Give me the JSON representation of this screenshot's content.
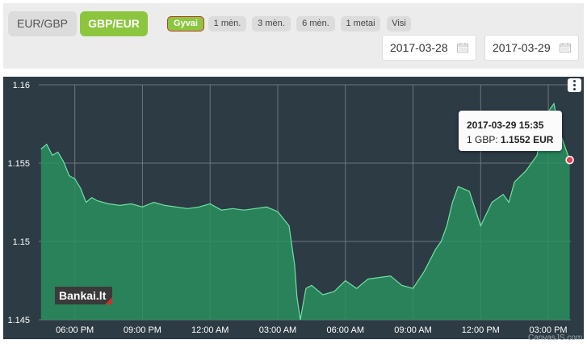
{
  "pair_tabs": [
    {
      "label": "EUR/GBP",
      "active": false
    },
    {
      "label": "GBP/EUR",
      "active": true
    }
  ],
  "range_buttons": [
    {
      "label": "Gyvai",
      "active": true
    },
    {
      "label": "1 mėn.",
      "active": false
    },
    {
      "label": "3 mėn.",
      "active": false
    },
    {
      "label": "6 mėn.",
      "active": false
    },
    {
      "label": "1 metai",
      "active": false
    },
    {
      "label": "Visi",
      "active": false
    }
  ],
  "date_from": "2017-03-28",
  "date_to": "2017-03-29",
  "icons": {
    "calendar": "calendar-icon",
    "menu": "more-vertical-icon"
  },
  "colors": {
    "accent": "#8cc63e",
    "chart_bg": "#2d3b44",
    "area_fill": "#2a8f5e",
    "line": "#6fe3a3",
    "marker": "#e04050"
  },
  "tooltip": {
    "date": "2017-03-29 15:35",
    "label": "1 GBP:",
    "value": "1.1552 EUR"
  },
  "watermark": "Bankai.lt",
  "credit": "CanvasJS.com",
  "chart_data": {
    "type": "area",
    "title": "",
    "xlabel": "",
    "ylabel": "",
    "ylim": [
      1.145,
      1.16
    ],
    "yticks": [
      "1.16",
      "1.155",
      "1.15",
      "1.145"
    ],
    "xticks": [
      "06:00 PM",
      "09:00 PM",
      "12:00 AM",
      "03:00 AM",
      "06:00 AM",
      "09:00 AM",
      "12:00 PM",
      "03:00 PM"
    ],
    "x_hours": [
      -1.5,
      -1.25,
      -1.0,
      -0.75,
      -0.5,
      -0.25,
      0,
      0.25,
      0.5,
      0.75,
      1.0,
      1.5,
      2.0,
      2.5,
      3.0,
      3.5,
      4.0,
      4.5,
      5.0,
      5.5,
      6.0,
      6.5,
      7.0,
      7.5,
      8.0,
      8.5,
      9.0,
      9.5,
      9.75,
      9.85,
      10.0,
      10.25,
      10.5,
      11.0,
      11.5,
      12.0,
      12.5,
      13.0,
      13.5,
      14.0,
      14.5,
      15.0,
      15.5,
      16.0,
      16.25,
      16.5,
      16.75,
      17.0,
      17.5,
      18.0,
      18.5,
      19.0,
      19.25,
      19.5,
      20.0,
      20.5,
      20.75,
      21.0,
      21.25,
      21.5,
      21.75,
      21.95
    ],
    "values": [
      1.1559,
      1.1562,
      1.1555,
      1.1557,
      1.1551,
      1.1542,
      1.154,
      1.1534,
      1.1525,
      1.1528,
      1.1526,
      1.1524,
      1.1523,
      1.1524,
      1.1522,
      1.1525,
      1.1523,
      1.1522,
      1.1521,
      1.1522,
      1.1524,
      1.152,
      1.1521,
      1.152,
      1.1521,
      1.1522,
      1.1519,
      1.151,
      1.1485,
      1.1465,
      1.145,
      1.147,
      1.1472,
      1.1466,
      1.1468,
      1.1475,
      1.147,
      1.1476,
      1.1477,
      1.1478,
      1.1472,
      1.147,
      1.1481,
      1.1495,
      1.15,
      1.151,
      1.1525,
      1.1535,
      1.1532,
      1.151,
      1.1525,
      1.153,
      1.1525,
      1.1538,
      1.1545,
      1.1555,
      1.1575,
      1.1583,
      1.1588,
      1.157,
      1.156,
      1.1552
    ],
    "tooltip_point": {
      "x": "2017-03-29 15:35",
      "y": 1.1552
    }
  }
}
